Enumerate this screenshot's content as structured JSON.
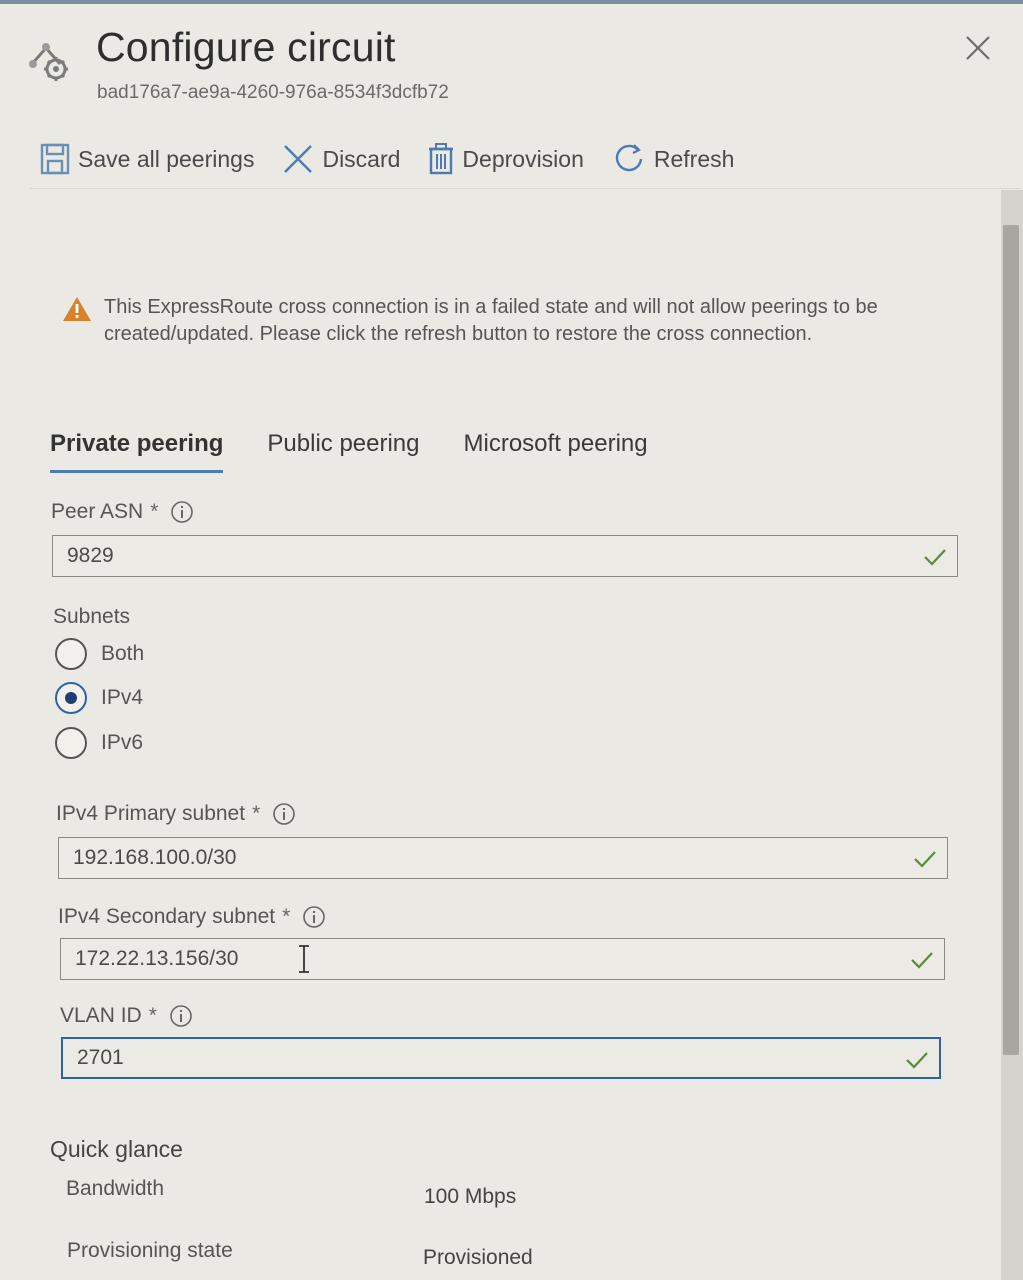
{
  "panel": {
    "title": "Configure circuit",
    "subtitle": "bad176a7-ae9a-4260-976a-8534f3dcfb72"
  },
  "toolbar": {
    "save_label": "Save all peerings",
    "discard_label": "Discard",
    "deprovision_label": "Deprovision",
    "refresh_label": "Refresh"
  },
  "warning": {
    "text": "This ExpressRoute cross connection is in a failed state and will not allow peerings to be created/updated. Please click the refresh button to restore the cross connection."
  },
  "tabs": [
    {
      "label": "Private peering",
      "active": true
    },
    {
      "label": "Public peering",
      "active": false
    },
    {
      "label": "Microsoft peering",
      "active": false
    }
  ],
  "form": {
    "peer_asn": {
      "label": "Peer ASN",
      "required": "*",
      "value": "9829"
    },
    "subnets": {
      "label": "Subnets",
      "options": [
        "Both",
        "IPv4",
        "IPv6"
      ],
      "selected": "IPv4"
    },
    "ipv4_primary": {
      "label": "IPv4 Primary subnet",
      "required": "*",
      "value": "192.168.100.0/30"
    },
    "ipv4_secondary": {
      "label": "IPv4 Secondary subnet",
      "required": "*",
      "value": "172.22.13.156/30"
    },
    "vlan_id": {
      "label": "VLAN ID",
      "required": "*",
      "value": "2701"
    }
  },
  "quick_glance": {
    "title": "Quick glance",
    "rows": [
      {
        "key": "Bandwidth",
        "value": "100 Mbps"
      },
      {
        "key": "Provisioning state",
        "value": "Provisioned"
      }
    ]
  },
  "colors": {
    "accent": "#2f63a6",
    "warning": "#d9822b"
  },
  "icons": [
    "circuit-icon",
    "close-icon",
    "save-icon",
    "discard-icon",
    "deprovision-icon",
    "refresh-icon",
    "warning-icon",
    "info-icon",
    "check-icon"
  ]
}
